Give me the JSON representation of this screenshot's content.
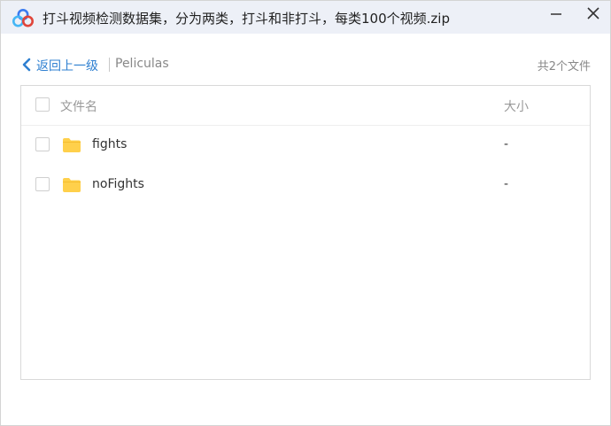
{
  "window": {
    "title": "打斗视频检测数据集，分为两类，打斗和非打斗，每类100个视频.zip"
  },
  "nav": {
    "back_label": "返回上一级",
    "current_folder": "Peliculas",
    "file_count": "共2个文件"
  },
  "list": {
    "columns": {
      "name": "文件名",
      "size": "大小"
    },
    "rows": [
      {
        "name": "fights",
        "size": "-",
        "icon": "folder-icon"
      },
      {
        "name": "noFights",
        "size": "-",
        "icon": "folder-icon"
      }
    ]
  },
  "colors": {
    "titlebar": "#edf0f7",
    "accent": "#2f80d1",
    "folder": "#ffd04b"
  }
}
